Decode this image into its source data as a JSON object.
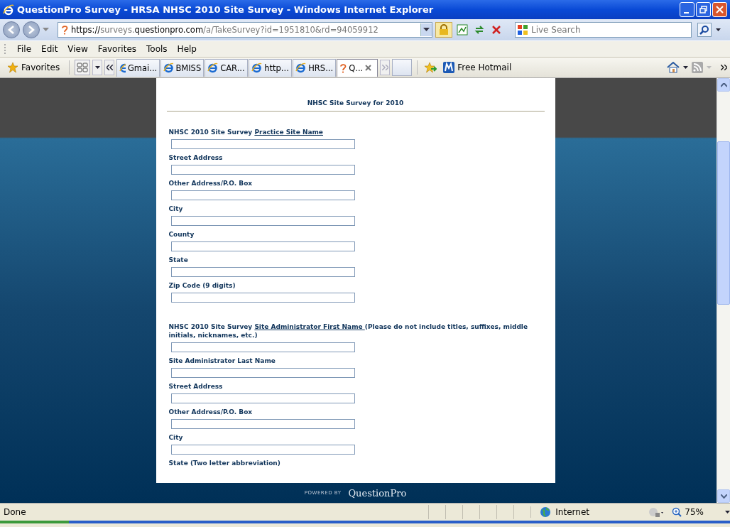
{
  "window": {
    "title": "QuestionPro Survey - HRSA NHSC 2010 Site Survey - Windows Internet Explorer"
  },
  "address": {
    "prefix": "https://",
    "host_dim": "surveys.",
    "host": "questionpro.com",
    "path": "/a/TakeSurvey?id=1951810&rd=94059912"
  },
  "search": {
    "placeholder": "Live Search"
  },
  "menu": [
    "File",
    "Edit",
    "View",
    "Favorites",
    "Tools",
    "Help"
  ],
  "favorites_label": "Favorites",
  "tabs": [
    {
      "label": "Gmai...",
      "selected": false,
      "kind": "ie"
    },
    {
      "label": "BMISS",
      "selected": false,
      "kind": "ie"
    },
    {
      "label": "CAR...",
      "selected": false,
      "kind": "ie"
    },
    {
      "label": "http...",
      "selected": false,
      "kind": "ie"
    },
    {
      "label": "HRS...",
      "selected": false,
      "kind": "ie"
    },
    {
      "label": "Q...",
      "selected": true,
      "kind": "qp"
    }
  ],
  "hotmail": "Free Hotmail",
  "survey": {
    "title": "NHSC Site Survey for 2010",
    "questions": [
      {
        "prefix": "NHSC 2010 Site Survey ",
        "link": "Practice Site Name",
        "section_break": false,
        "has_field": true
      },
      {
        "prefix": "Street Address",
        "section_break": false,
        "has_field": true
      },
      {
        "prefix": "Other Address/P.O. Box",
        "section_break": false,
        "has_field": true
      },
      {
        "prefix": "City",
        "section_break": false,
        "has_field": true
      },
      {
        "prefix": "County",
        "section_break": false,
        "has_field": true
      },
      {
        "prefix": "State",
        "section_break": false,
        "has_field": true
      },
      {
        "prefix": "Zip Code (9 digits)",
        "section_break": false,
        "has_field": true
      },
      {
        "prefix": "NHSC 2010 Site Survey ",
        "link": "Site Administrator First Name ",
        "suffix": "(Please do not include titles, suffixes, middle initials, nicknames, etc.)",
        "section_break": true,
        "has_field": true
      },
      {
        "prefix": "Site Administrator Last Name",
        "section_break": false,
        "has_field": true
      },
      {
        "prefix": "Street Address",
        "section_break": false,
        "has_field": true
      },
      {
        "prefix": "Other Address/P.O. Box",
        "section_break": false,
        "has_field": true
      },
      {
        "prefix": "City",
        "section_break": false,
        "has_field": true
      },
      {
        "prefix": "State (Two letter abbreviation)",
        "section_break": false,
        "has_field": false
      }
    ],
    "powered_by": "POWERED BY",
    "brand": "QuestionPro"
  },
  "status": {
    "text": "Done",
    "zone": "Internet",
    "zoom": "75%"
  }
}
